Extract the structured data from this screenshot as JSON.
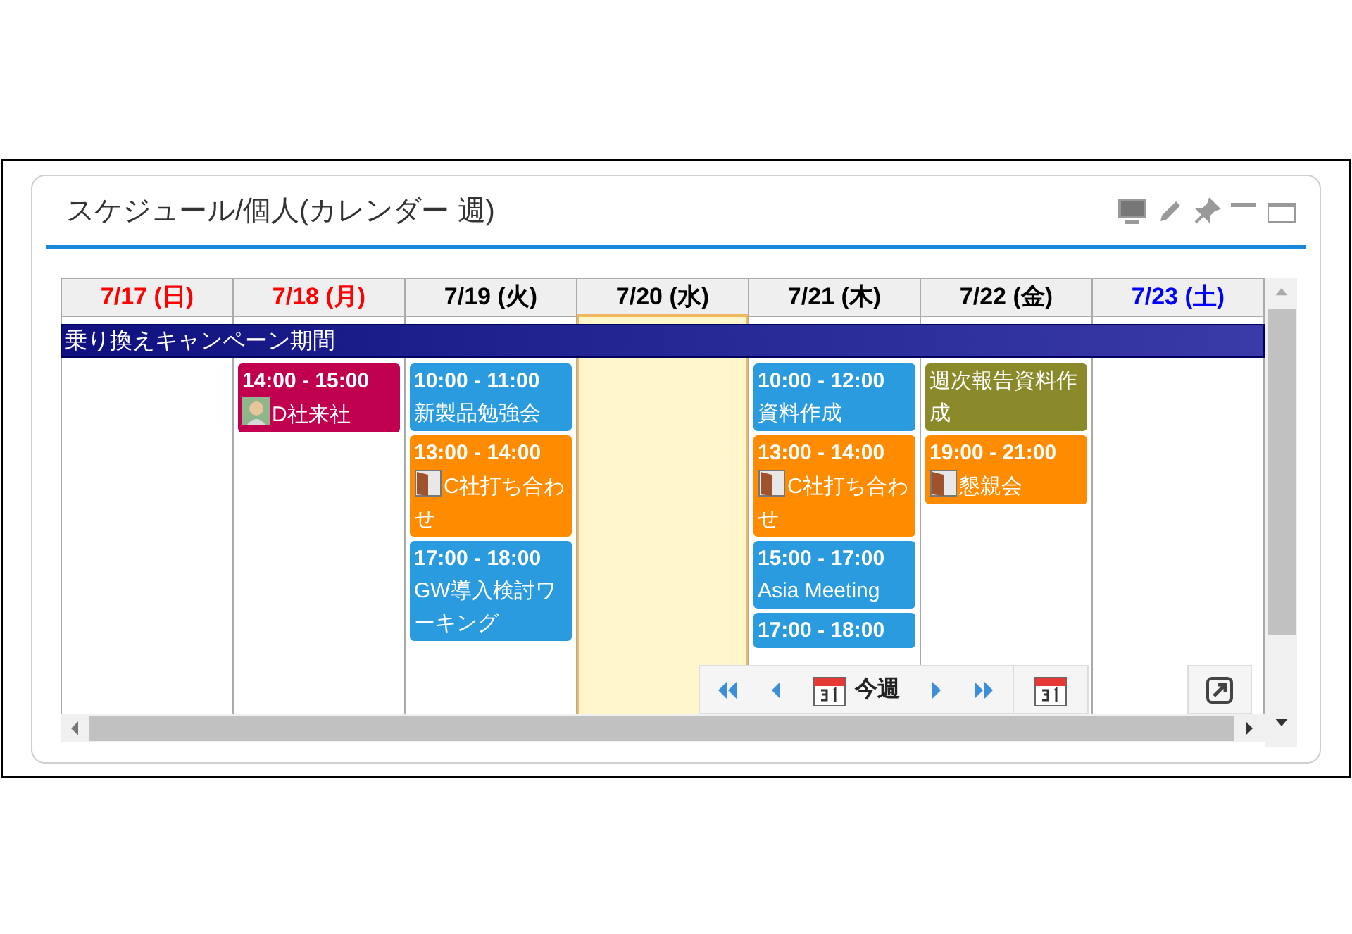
{
  "panel": {
    "title": "スケジュール/個人(カレンダー 週)"
  },
  "days": [
    {
      "label": "7/17 (日)",
      "color": "#ff0000",
      "selected": false
    },
    {
      "label": "7/18 (月)",
      "color": "#ff0000",
      "selected": false,
      "events": [
        {
          "kind": "visitor",
          "time": "14:00 - 15:00",
          "title": "D社来社",
          "color": "#c0004f"
        }
      ]
    },
    {
      "label": "7/19 (火)",
      "color": "#000000",
      "selected": false,
      "events": [
        {
          "kind": "plain",
          "time": "10:00 - 11:00",
          "title": "新製品勉強会",
          "color": "#2b9be0"
        },
        {
          "kind": "room",
          "time": "13:00 - 14:00",
          "title": "C社打ち合わせ",
          "color": "#ff8c00"
        },
        {
          "kind": "plain",
          "time": "17:00 - 18:00",
          "title": "GW導入検討ワーキング",
          "color": "#2b9be0"
        }
      ]
    },
    {
      "label": "7/20 (水)",
      "color": "#000000",
      "selected": true
    },
    {
      "label": "7/21 (木)",
      "color": "#000000",
      "selected": false,
      "events": [
        {
          "kind": "plain",
          "time": "10:00 - 12:00",
          "title": "資料作成",
          "color": "#2b9be0"
        },
        {
          "kind": "room",
          "time": "13:00 - 14:00",
          "title": "C社打ち合わせ",
          "color": "#ff8c00"
        },
        {
          "kind": "plain",
          "time": "15:00 - 17:00",
          "title": "Asia Meeting",
          "color": "#2b9be0"
        },
        {
          "kind": "plain",
          "time": "17:00 - 18:00",
          "color": "#2b9be0"
        }
      ]
    },
    {
      "label": "7/22 (金)",
      "color": "#000000",
      "selected": false,
      "events": [
        {
          "kind": "plain",
          "title": "週次報告資料作成",
          "color": "#8a8a2a"
        },
        {
          "kind": "room",
          "time": "19:00 - 21:00",
          "title": "懇親会",
          "color": "#ff8c00"
        }
      ]
    },
    {
      "label": "7/23 (土)",
      "color": "#0000ff",
      "selected": false
    }
  ],
  "banner": {
    "title": "乗り換えキャンペーン期間"
  },
  "toolbar": {
    "today_label": "今週"
  }
}
